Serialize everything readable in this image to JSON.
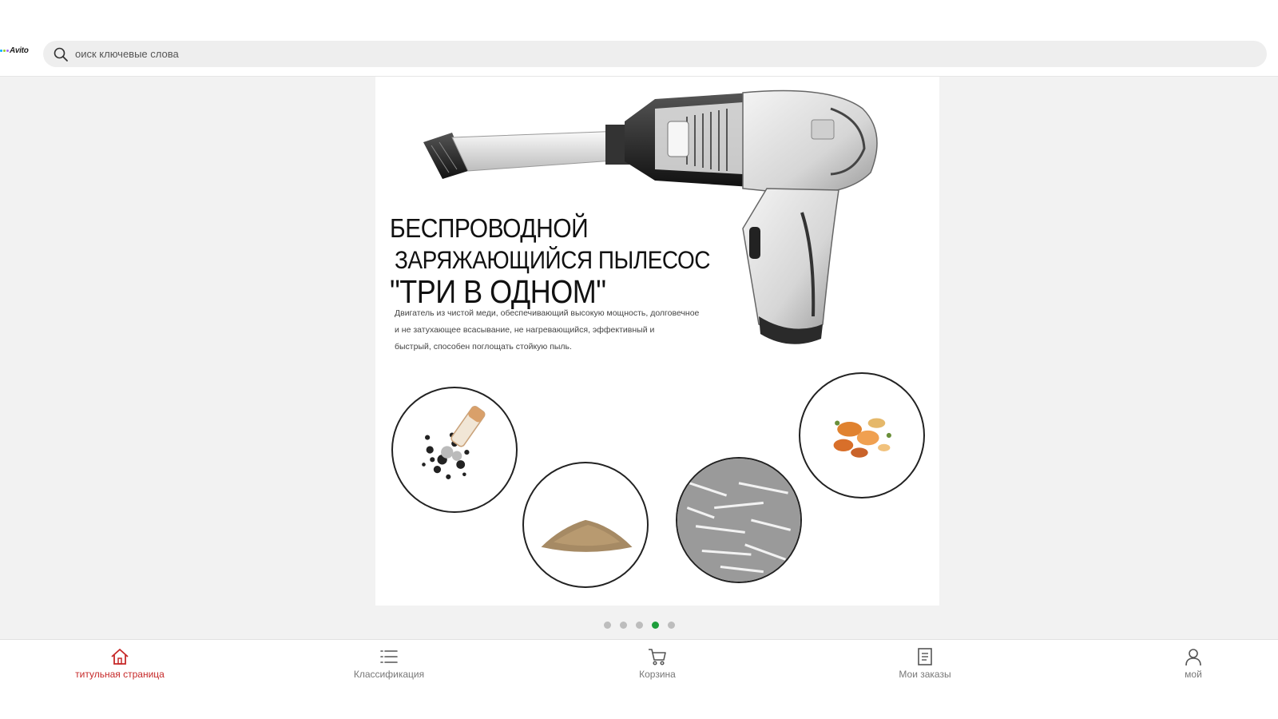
{
  "header": {
    "logo_text": "Avito",
    "logo_dot_colors": [
      "#00aaff",
      "#97cf26",
      "#a169f7",
      "#ff6163"
    ],
    "search": {
      "placeholder": "оиск ключевые слова",
      "value": ""
    }
  },
  "banner": {
    "headline": {
      "line1": "БЕСПРОВОДНОЙ",
      "line2": "ЗАРЯЖАЮЩИЙСЯ ПЫЛЕСОС",
      "line3": "\"ТРИ В ОДНОМ\""
    },
    "description": [
      "Двигатель из чистой меди, обеспечивающий высокую мощность, долговечное",
      "и не затухающее всасывание, не нагревающийся, эффективный и",
      "быстрый, способен поглощать стойкую пыль."
    ]
  },
  "pager": {
    "count": 5,
    "active_index": 3,
    "active_color": "#1e9e3c",
    "inactive_color": "#bdbdbd"
  },
  "bottom_nav": {
    "active_color": "#c62828",
    "items": [
      {
        "label": "титульная страница",
        "icon": "home-icon",
        "active": true
      },
      {
        "label": "Классификация",
        "icon": "list-icon",
        "active": false
      },
      {
        "label": "Корзина",
        "icon": "cart-icon",
        "active": false
      },
      {
        "label": "Мои заказы",
        "icon": "orders-icon",
        "active": false
      },
      {
        "label": "мой",
        "icon": "user-icon",
        "active": false
      }
    ]
  }
}
